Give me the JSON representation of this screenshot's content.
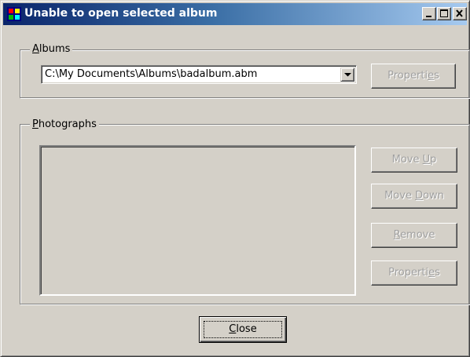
{
  "window": {
    "title": "Unable to open selected album"
  },
  "albums_group": {
    "label_prefix": "",
    "label_mnemonic": "A",
    "label_rest": "lbums",
    "combo_value": "C:\\My Documents\\Albums\\badalbum.abm",
    "properties_button": {
      "pre": "Properti",
      "mnemonic": "e",
      "post": "s"
    }
  },
  "photos_group": {
    "label_mnemonic": "P",
    "label_rest": "hotographs",
    "move_up_button": {
      "pre": "Move ",
      "mnemonic": "U",
      "post": "p"
    },
    "move_down_button": {
      "pre": "Move ",
      "mnemonic": "D",
      "post": "own"
    },
    "remove_button": {
      "pre": "",
      "mnemonic": "R",
      "post": "emove"
    },
    "properties_button": {
      "pre": "Properti",
      "mnemonic": "e",
      "post": "s"
    }
  },
  "footer": {
    "close_button": {
      "pre": "",
      "mnemonic": "C",
      "post": "lose"
    }
  },
  "colors": {
    "face": "#d4d0c8",
    "title_start": "#0a246a",
    "title_end": "#a6caf0",
    "disabled_text": "#a0a0a0"
  },
  "icons": {
    "app": "album-app-icon",
    "minimize": "minimize-icon",
    "maximize": "maximize-icon",
    "close": "close-icon",
    "dropdown": "chevron-down-icon"
  }
}
